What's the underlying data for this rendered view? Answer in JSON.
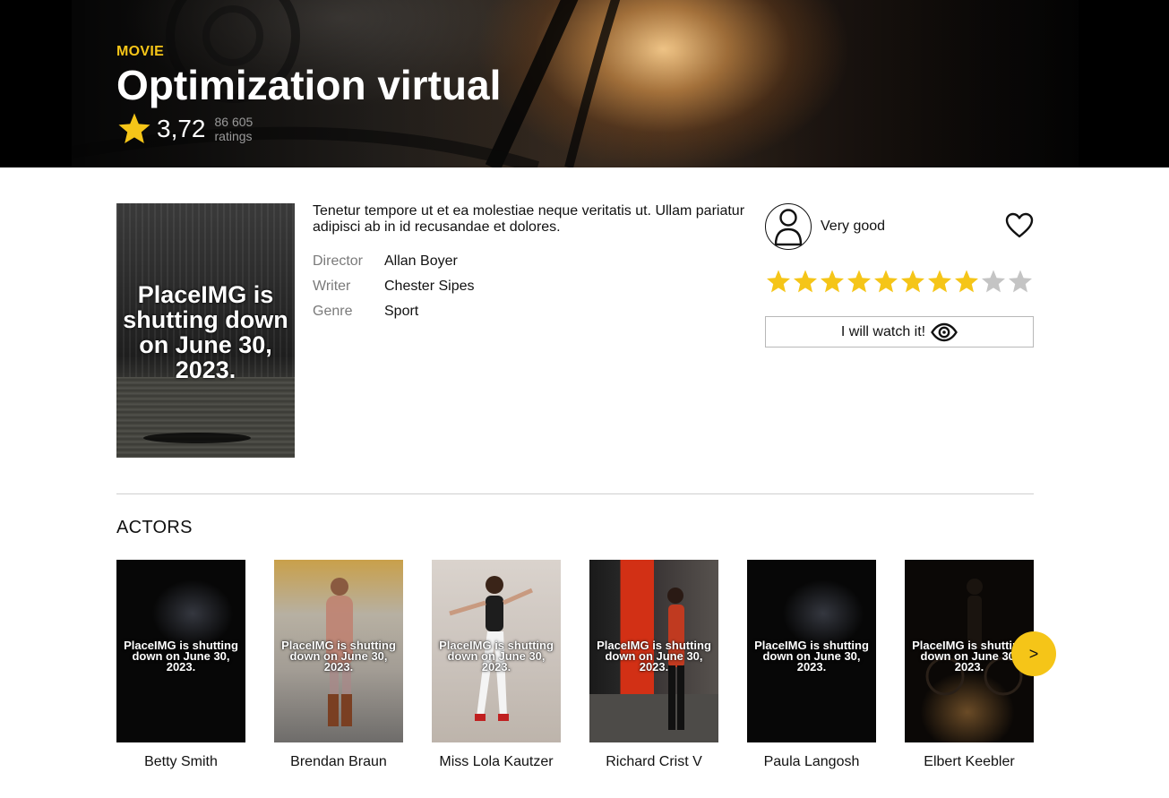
{
  "colors": {
    "accent": "#f5c518",
    "star_empty": "#c4c4c4"
  },
  "movie": {
    "type_label": "MOVIE",
    "title": "Optimization virtual",
    "rating": "3,72",
    "ratings_count": "86 605",
    "ratings_label": "ratings",
    "poster_text": "PlaceIMG is shutting down on June 30, 2023.",
    "description": "Tenetur tempore ut et ea molestiae neque veritatis ut. Ullam pariatur adipisci ab in id recusandae et dolores.",
    "details": [
      {
        "key": "Director",
        "value": "Allan Boyer"
      },
      {
        "key": "Writer",
        "value": "Chester Sipes"
      },
      {
        "key": "Genre",
        "value": "Sport"
      }
    ]
  },
  "user_rating": {
    "label": "Very good",
    "stars_filled": 8,
    "stars_total": 10,
    "avatar_icon": "user-icon",
    "favorite_icon": "heart-icon"
  },
  "watch_button": {
    "label": "I will watch it!",
    "icon": "eye-icon"
  },
  "actors": {
    "title": "ACTORS",
    "items": [
      {
        "name": "Betty Smith",
        "photo_text": "PlaceIMG is shutting down on June 30, 2023."
      },
      {
        "name": "Brendan Braun",
        "photo_text": "PlaceIMG is shutting down on June 30, 2023."
      },
      {
        "name": "Miss Lola Kautzer",
        "photo_text": "PlaceIMG is shutting down on June 30, 2023."
      },
      {
        "name": "Richard Crist V",
        "photo_text": "PlaceIMG is shutting down on June 30, 2023."
      },
      {
        "name": "Paula Langosh",
        "photo_text": "PlaceIMG is shutting down on June 30, 2023."
      },
      {
        "name": "Elbert Keebler",
        "photo_text": "PlaceIMG is shutting down on June 30, 2023."
      }
    ],
    "next_label": ">"
  }
}
